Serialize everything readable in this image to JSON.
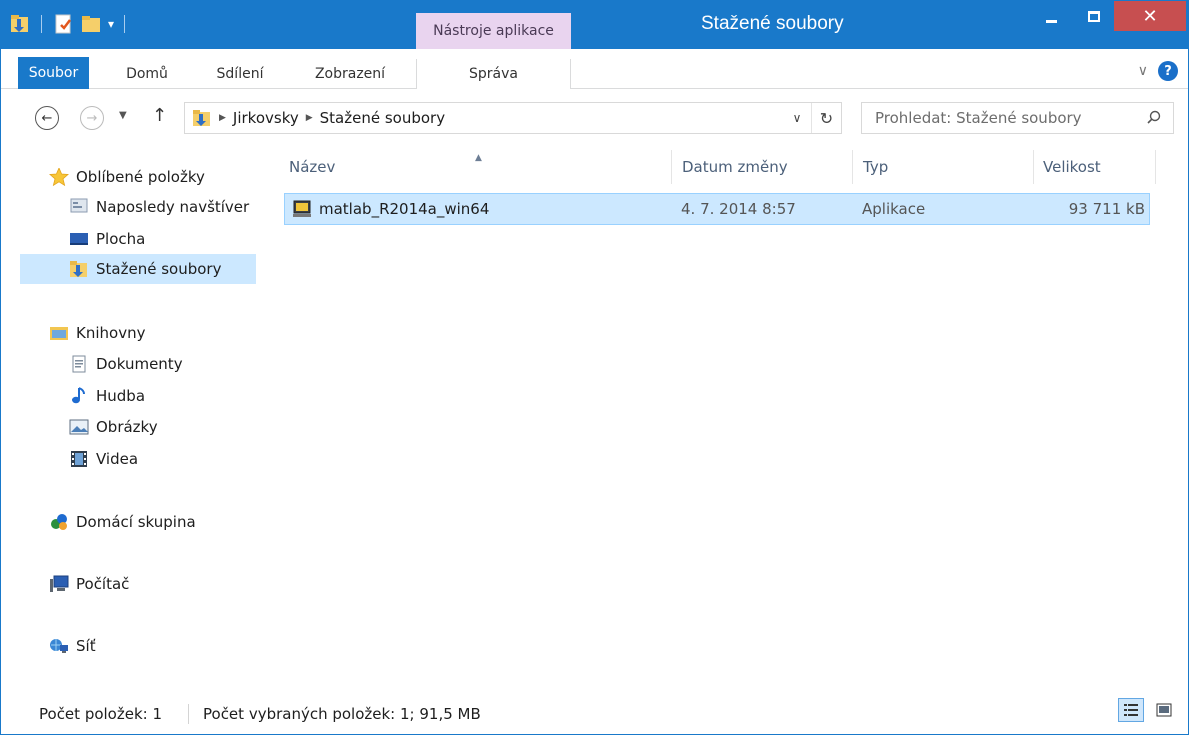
{
  "window": {
    "title": "Stažené soubory",
    "context_tab_header": "Nástroje aplikace",
    "close_glyph": "✕",
    "accent_color": "#1979ca",
    "context_color": "#e9d4ef"
  },
  "ribbon": {
    "tabs": [
      {
        "label": "Soubor"
      },
      {
        "label": "Domů"
      },
      {
        "label": "Sdílení"
      },
      {
        "label": "Zobrazení"
      },
      {
        "label": "Správa"
      }
    ]
  },
  "address": {
    "crumbs": [
      "Jirkovsky",
      "Stažené soubory"
    ],
    "search_placeholder": "Prohledat: Stažené soubory"
  },
  "navigation": {
    "favorites": {
      "label": "Oblíbené položky",
      "items": [
        "Naposledy navštíver",
        "Plocha",
        "Stažené soubory"
      ]
    },
    "libraries": {
      "label": "Knihovny",
      "items": [
        "Dokumenty",
        "Hudba",
        "Obrázky",
        "Videa"
      ]
    },
    "homegroup": "Domácí skupina",
    "computer": "Počítač",
    "network": "Síť"
  },
  "columns": {
    "name": "Název",
    "date": "Datum změny",
    "type": "Typ",
    "size": "Velikost"
  },
  "files": [
    {
      "name": "matlab_R2014a_win64",
      "date": "4. 7. 2014 8:57",
      "type": "Aplikace",
      "size": "93 711 kB",
      "selected": true
    }
  ],
  "status": {
    "item_count": "Počet položek: 1",
    "selected_count": "Počet vybraných položek: 1; 91,5 MB"
  }
}
